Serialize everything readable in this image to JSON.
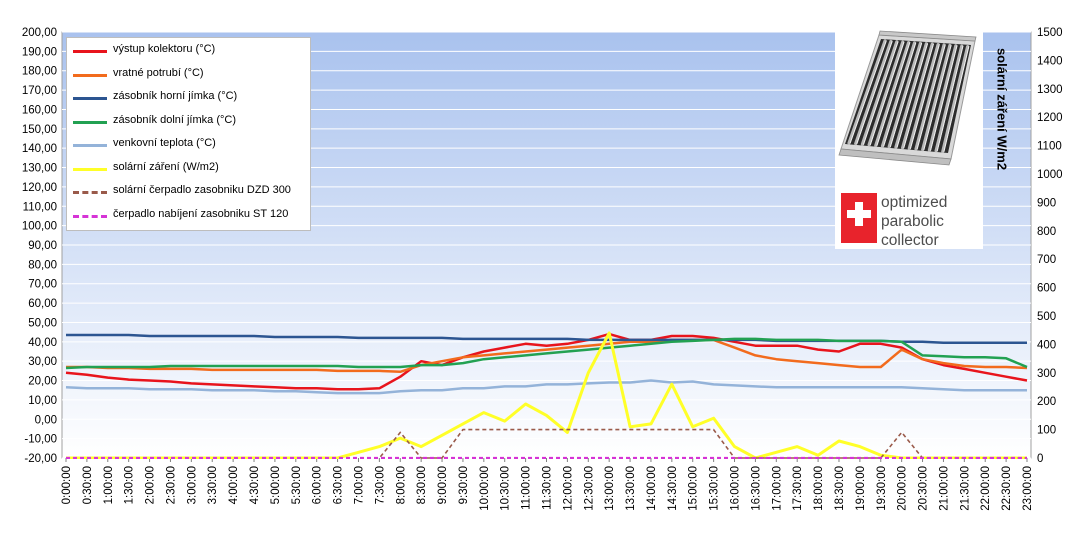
{
  "chart_data": {
    "type": "line",
    "title": "",
    "xlabel": "",
    "ylabel": "",
    "y2label": "solární záření W/m2",
    "ylim": [
      -20,
      200
    ],
    "y2lim": [
      0,
      1500
    ],
    "yticks": [
      "-20,00",
      "-10,00",
      "0,00",
      "10,00",
      "20,00",
      "30,00",
      "40,00",
      "50,00",
      "60,00",
      "70,00",
      "80,00",
      "90,00",
      "100,00",
      "110,00",
      "120,00",
      "130,00",
      "140,00",
      "150,00",
      "160,00",
      "170,00",
      "180,00",
      "190,00",
      "200,00"
    ],
    "y2ticks": [
      "0",
      "100",
      "200",
      "300",
      "400",
      "500",
      "600",
      "700",
      "800",
      "900",
      "1000",
      "1100",
      "1200",
      "1300",
      "1400",
      "1500"
    ],
    "categories": [
      "0:00:00",
      "0:30:00",
      "1:00:00",
      "1:30:00",
      "2:00:00",
      "2:30:00",
      "3:00:00",
      "3:30:00",
      "4:00:00",
      "4:30:00",
      "5:00:00",
      "5:30:00",
      "6:00:00",
      "6:30:00",
      "7:00:00",
      "7:30:00",
      "8:00:00",
      "8:30:00",
      "9:00:00",
      "9:30:00",
      "10:00:00",
      "10:30:00",
      "11:00:00",
      "11:30:00",
      "12:00:00",
      "12:30:00",
      "13:00:00",
      "13:30:00",
      "14:00:00",
      "14:30:00",
      "15:00:00",
      "15:30:00",
      "16:00:00",
      "16:30:00",
      "17:00:00",
      "17:30:00",
      "18:00:00",
      "18:30:00",
      "19:00:00",
      "19:30:00",
      "20:00:00",
      "20:30:00",
      "21:00:00",
      "21:30:00",
      "22:00:00",
      "22:30:00",
      "23:00:00"
    ],
    "grid": true,
    "legend_position": "top-left",
    "background_gradient": [
      "#a9c2ee",
      "#ffffff"
    ],
    "series": [
      {
        "name": "výstup kolektoru (°C)",
        "axis": "left",
        "color": "#e8141c",
        "width": 2.5,
        "dash": "",
        "values": [
          24,
          23,
          21.5,
          20.5,
          20,
          19.5,
          18.5,
          18,
          17.5,
          17,
          16.5,
          16,
          16,
          15.5,
          15.5,
          16,
          22,
          30,
          28,
          32,
          35,
          37,
          39,
          38,
          39,
          41,
          44,
          41,
          41,
          43,
          43,
          42,
          40,
          38,
          38,
          38,
          36,
          35,
          39,
          39,
          37,
          31,
          28,
          26,
          24,
          22,
          20
        ]
      },
      {
        "name": "vratné potrubí (°C)",
        "axis": "left",
        "color": "#f26b1d",
        "width": 2.5,
        "dash": "",
        "values": [
          27,
          27,
          26.5,
          26.5,
          26,
          26,
          26,
          25.5,
          25.5,
          25.5,
          25.5,
          25.5,
          25.5,
          25,
          25,
          25,
          24.5,
          28,
          30,
          32,
          33,
          34,
          35,
          36,
          37,
          38,
          39,
          40,
          40,
          41,
          41,
          41,
          37,
          33,
          31,
          30,
          29,
          28,
          27,
          27,
          36,
          31,
          29,
          27.5,
          27,
          27,
          26.5
        ]
      },
      {
        "name": "zásobník horní jímka (°C)",
        "axis": "left",
        "color": "#2c5591",
        "width": 2.5,
        "dash": "",
        "values": [
          43.5,
          43.5,
          43.5,
          43.5,
          43,
          43,
          43,
          43,
          43,
          43,
          42.5,
          42.5,
          42.5,
          42.5,
          42,
          42,
          42,
          42,
          42,
          41.5,
          41.5,
          41.5,
          41.5,
          41.5,
          41.5,
          41,
          41,
          41,
          41,
          41,
          41,
          41,
          41,
          41,
          40.5,
          40.5,
          40.5,
          40.5,
          40.5,
          40.5,
          40,
          40,
          39.5,
          39.5,
          39.5,
          39.5,
          39.5
        ]
      },
      {
        "name": "zásobník dolní jímka  (°C)",
        "axis": "left",
        "color": "#22a152",
        "width": 2.5,
        "dash": "",
        "values": [
          26.5,
          27,
          27,
          27,
          27,
          27.5,
          27.5,
          27.5,
          27.5,
          27.5,
          27.5,
          27.5,
          27.5,
          27.5,
          27,
          27,
          27,
          28,
          28,
          29,
          31,
          32,
          33,
          34,
          35,
          36,
          37,
          38,
          39,
          40,
          40.5,
          41,
          41.5,
          41.5,
          41,
          41,
          41,
          40.5,
          40.5,
          40.5,
          40,
          33,
          32.5,
          32,
          32,
          31.5,
          27
        ]
      },
      {
        "name": "venkovní teplota (°C)",
        "axis": "left",
        "color": "#94b3d9",
        "width": 2.5,
        "dash": "",
        "values": [
          16.5,
          16,
          16,
          16,
          15.5,
          15.5,
          15.5,
          15,
          15,
          15,
          14.5,
          14.5,
          14,
          13.5,
          13.5,
          13.5,
          14.5,
          15,
          15,
          16,
          16,
          17,
          17,
          18,
          18,
          18.5,
          19,
          19,
          20,
          19,
          19.5,
          18,
          17.5,
          17,
          16.5,
          16.5,
          16.5,
          16.5,
          16.5,
          16.5,
          16.5,
          16,
          15.5,
          15,
          15,
          15,
          15
        ]
      },
      {
        "name": "solární záření  (W/m2)",
        "axis": "right",
        "color": "#ffff28",
        "width": 3,
        "dash": "",
        "values": [
          0,
          0,
          0,
          0,
          0,
          0,
          0,
          0,
          0,
          0,
          0,
          0,
          0,
          0,
          20,
          40,
          70,
          40,
          80,
          120,
          160,
          130,
          190,
          150,
          90,
          300,
          440,
          110,
          120,
          260,
          110,
          140,
          40,
          0,
          20,
          40,
          10,
          60,
          40,
          10,
          0,
          0,
          0,
          0,
          0,
          0,
          0
        ]
      },
      {
        "name": "solární čerpadlo zasobniku  DZD 300",
        "axis": "right",
        "color": "#9a5a4a",
        "width": 1.6,
        "dash": "4,3",
        "values": [
          0,
          0,
          0,
          0,
          0,
          0,
          0,
          0,
          0,
          0,
          0,
          0,
          0,
          0,
          0,
          0,
          90,
          0,
          0,
          100,
          100,
          100,
          100,
          100,
          100,
          100,
          100,
          100,
          100,
          100,
          100,
          100,
          0,
          0,
          0,
          0,
          0,
          0,
          0,
          0,
          90,
          0,
          0,
          0,
          0,
          0,
          0
        ]
      },
      {
        "name": "čerpadlo nabíjení  zasobniku ST 120",
        "axis": "right",
        "color": "#d633d6",
        "width": 2.2,
        "dash": "4,3",
        "values": [
          0,
          0,
          0,
          0,
          0,
          0,
          0,
          0,
          0,
          0,
          0,
          0,
          0,
          0,
          0,
          0,
          0,
          0,
          0,
          0,
          0,
          0,
          0,
          0,
          0,
          0,
          0,
          0,
          0,
          0,
          0,
          0,
          0,
          0,
          0,
          0,
          0,
          0,
          0,
          0,
          0,
          0,
          0,
          0,
          0,
          0,
          0
        ]
      }
    ]
  },
  "logo": {
    "brand_lines": [
      "optimized",
      "parabolic",
      "collector"
    ],
    "cross_color": "#e8232c"
  }
}
